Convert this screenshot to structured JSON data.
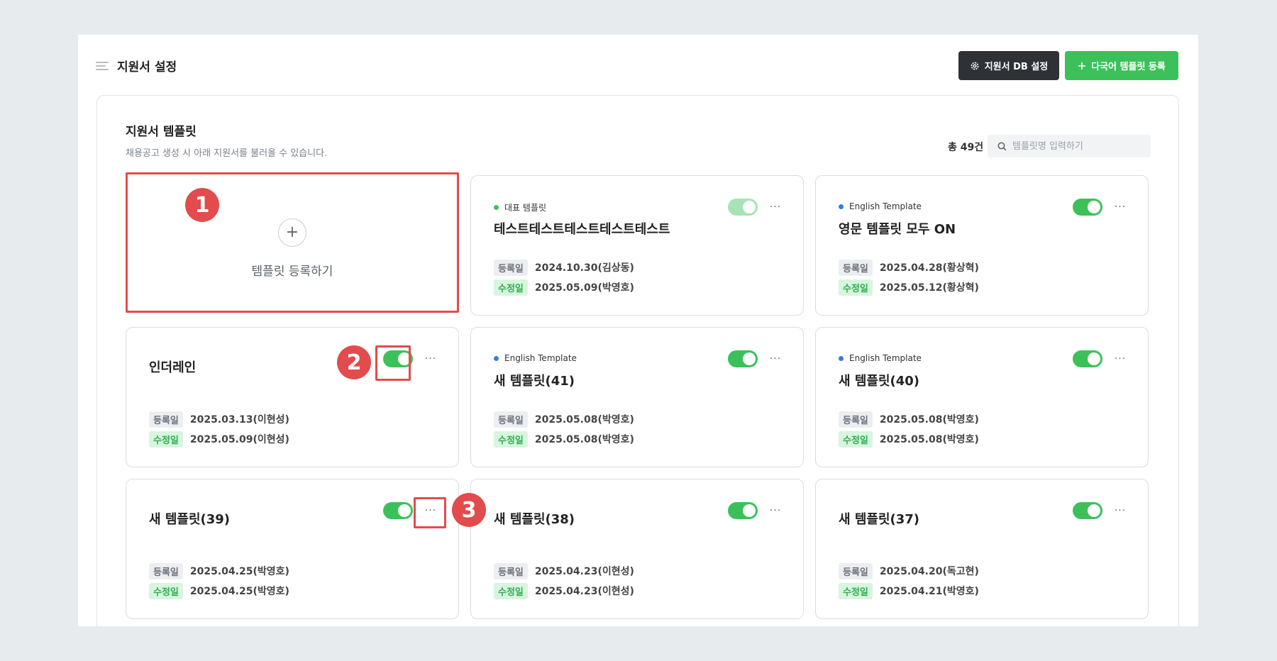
{
  "header": {
    "title": "지원서 설정",
    "db_button": "지원서 DB 설정",
    "register_button": "다국어 템플릿 등록"
  },
  "section": {
    "title": "지원서 템플릿",
    "description": "채용공고 생성 시 아래 지원서를 불러올 수 있습니다.",
    "count": "총 49건",
    "search_placeholder": "템플릿명 입력하기"
  },
  "add_card": {
    "label": "템플릿 등록하기"
  },
  "labels": {
    "registered": "등록일",
    "modified": "수정일"
  },
  "cards": [
    {
      "tag": "대표 템플릿",
      "tag_color": "#3cc15a",
      "name": "테스트테스트테스트테스트테스트",
      "registered": "2024.10.30(김상동)",
      "modified": "2025.05.09(박영호)",
      "toggle_on": true,
      "toggle_dimmed": true
    },
    {
      "tag": "English Template",
      "tag_color": "#2f7fe0",
      "name": "영문 템플릿 모두 ON",
      "registered": "2025.04.28(황상혁)",
      "modified": "2025.05.12(황상혁)",
      "toggle_on": true
    },
    {
      "tag": "",
      "name": "인더레인",
      "registered": "2025.03.13(이현성)",
      "modified": "2025.05.09(이현성)",
      "toggle_on": true
    },
    {
      "tag": "English Template",
      "tag_color": "#2f7fe0",
      "name": "새 템플릿(41)",
      "registered": "2025.05.08(박영호)",
      "modified": "2025.05.08(박영호)",
      "toggle_on": true
    },
    {
      "tag": "English Template",
      "tag_color": "#2f7fe0",
      "name": "새 템플릿(40)",
      "registered": "2025.05.08(박영호)",
      "modified": "2025.05.08(박영호)",
      "toggle_on": true
    },
    {
      "tag": "",
      "name": "새 템플릿(39)",
      "registered": "2025.04.25(박영호)",
      "modified": "2025.04.25(박영호)",
      "toggle_on": true
    },
    {
      "tag": "",
      "name": "새 템플릿(38)",
      "registered": "2025.04.23(이현성)",
      "modified": "2025.04.23(이현성)",
      "toggle_on": true
    },
    {
      "tag": "",
      "name": "새 템플릿(37)",
      "registered": "2025.04.20(독고현)",
      "modified": "2025.04.21(박영호)",
      "toggle_on": true
    }
  ],
  "annotations": [
    "1",
    "2",
    "3"
  ],
  "colors": {
    "accent_green": "#3cc15a",
    "dark_button": "#2e3237",
    "callout_red": "#e24c4c"
  }
}
